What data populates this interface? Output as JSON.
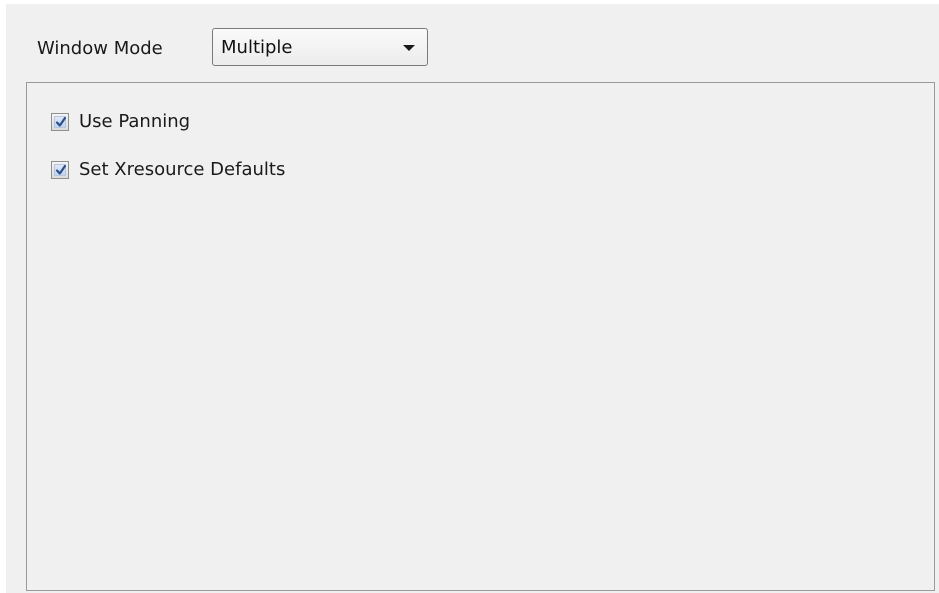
{
  "window_mode": {
    "label": "Window Mode",
    "selected": "Multiple"
  },
  "options": [
    {
      "label": "Use Panning",
      "checked": true
    },
    {
      "label": "Set Xresource Defaults",
      "checked": true
    }
  ],
  "colors": {
    "panel_background": "#f0f0f0",
    "border": "#9a9a9a",
    "check_mark": "#2b4f8c"
  }
}
